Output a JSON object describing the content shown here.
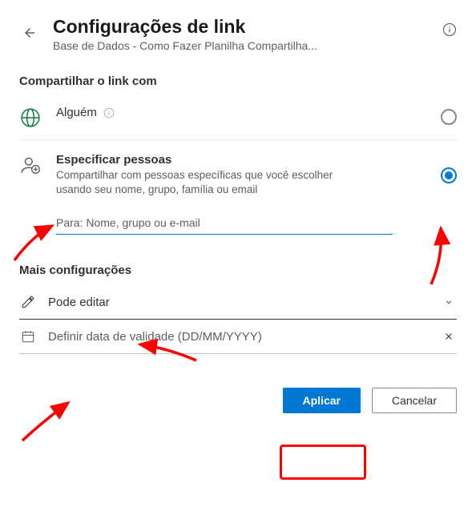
{
  "header": {
    "title": "Configurações de link",
    "subtitle": "Base de Dados - Como Fazer Planilha Compartilha..."
  },
  "share_section_label": "Compartilhar o link com",
  "option_anyone": {
    "title": "Alguém"
  },
  "option_specific": {
    "title": "Especificar pessoas",
    "desc": "Compartilhar com pessoas específicas que você escolher usando seu nome, grupo, família ou email",
    "to_label": "Para: Nome, grupo ou e-mail"
  },
  "more_settings_label": "Mais configurações",
  "permission_row": {
    "label": "Pode editar"
  },
  "expiry_row": {
    "placeholder": "Definir data de validade (DD/MM/YYYY)"
  },
  "footer": {
    "apply": "Aplicar",
    "cancel": "Cancelar"
  }
}
